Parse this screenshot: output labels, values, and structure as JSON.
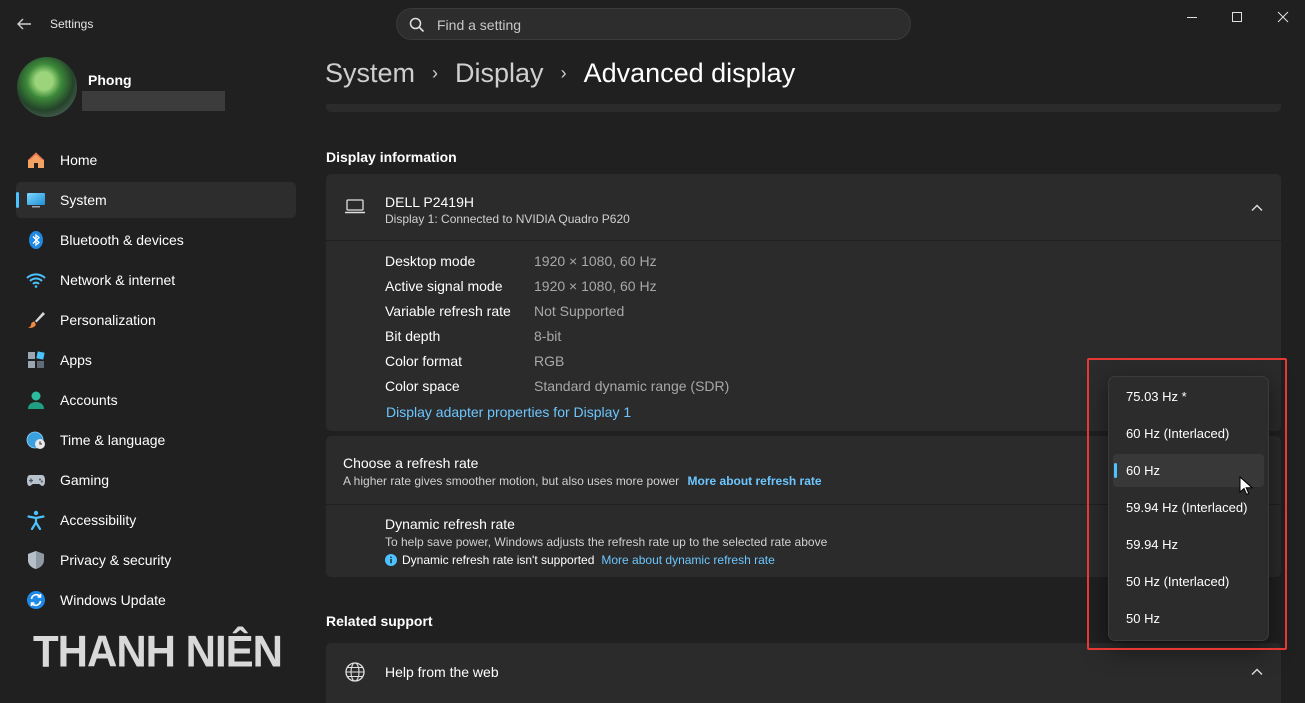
{
  "window": {
    "title": "Settings"
  },
  "search": {
    "placeholder": "Find a setting"
  },
  "profile": {
    "name": "Phong"
  },
  "sidebar": {
    "items": [
      {
        "label": "Home",
        "icon": "home-icon",
        "active": false
      },
      {
        "label": "System",
        "icon": "system-icon",
        "active": true
      },
      {
        "label": "Bluetooth & devices",
        "icon": "bluetooth-icon",
        "active": false
      },
      {
        "label": "Network & internet",
        "icon": "wifi-icon",
        "active": false
      },
      {
        "label": "Personalization",
        "icon": "brush-icon",
        "active": false
      },
      {
        "label": "Apps",
        "icon": "apps-icon",
        "active": false
      },
      {
        "label": "Accounts",
        "icon": "person-icon",
        "active": false
      },
      {
        "label": "Time & language",
        "icon": "clock-globe-icon",
        "active": false
      },
      {
        "label": "Gaming",
        "icon": "gamepad-icon",
        "active": false
      },
      {
        "label": "Accessibility",
        "icon": "accessibility-icon",
        "active": false
      },
      {
        "label": "Privacy & security",
        "icon": "shield-icon",
        "active": false
      },
      {
        "label": "Windows Update",
        "icon": "update-icon",
        "active": false
      }
    ]
  },
  "watermark": "THANH NIÊN",
  "breadcrumb": {
    "parts": [
      "System",
      "Display",
      "Advanced display"
    ]
  },
  "display_info": {
    "section_title": "Display information",
    "monitor_name": "DELL P2419H",
    "monitor_sub": "Display 1: Connected to NVIDIA Quadro P620",
    "rows": [
      {
        "label": "Desktop mode",
        "value": "1920 × 1080, 60 Hz"
      },
      {
        "label": "Active signal mode",
        "value": "1920 × 1080, 60 Hz"
      },
      {
        "label": "Variable refresh rate",
        "value": "Not Supported"
      },
      {
        "label": "Bit depth",
        "value": "8-bit"
      },
      {
        "label": "Color format",
        "value": "RGB"
      },
      {
        "label": "Color space",
        "value": "Standard dynamic range (SDR)"
      }
    ],
    "adapter_link": "Display adapter properties for Display 1"
  },
  "refresh": {
    "title": "Choose a refresh rate",
    "description": "A higher rate gives smoother motion, but also uses more power",
    "link": "More about refresh rate",
    "dynamic_title": "Dynamic refresh rate",
    "dynamic_description": "To help save power, Windows adjusts the refresh rate up to the selected rate above",
    "dynamic_note": "Dynamic refresh rate isn't supported",
    "dynamic_link": "More about dynamic refresh rate",
    "options": [
      "75.03 Hz *",
      "60 Hz (Interlaced)",
      "60 Hz",
      "59.94 Hz (Interlaced)",
      "59.94 Hz",
      "50 Hz (Interlaced)",
      "50 Hz"
    ],
    "selected": "60 Hz"
  },
  "related": {
    "section_title": "Related support",
    "help_label": "Help from the web"
  },
  "colors": {
    "accent": "#4cc2ff",
    "link": "#6cc6ff",
    "highlight": "#e53935",
    "background": "#202020",
    "card": "#2b2b2b"
  }
}
